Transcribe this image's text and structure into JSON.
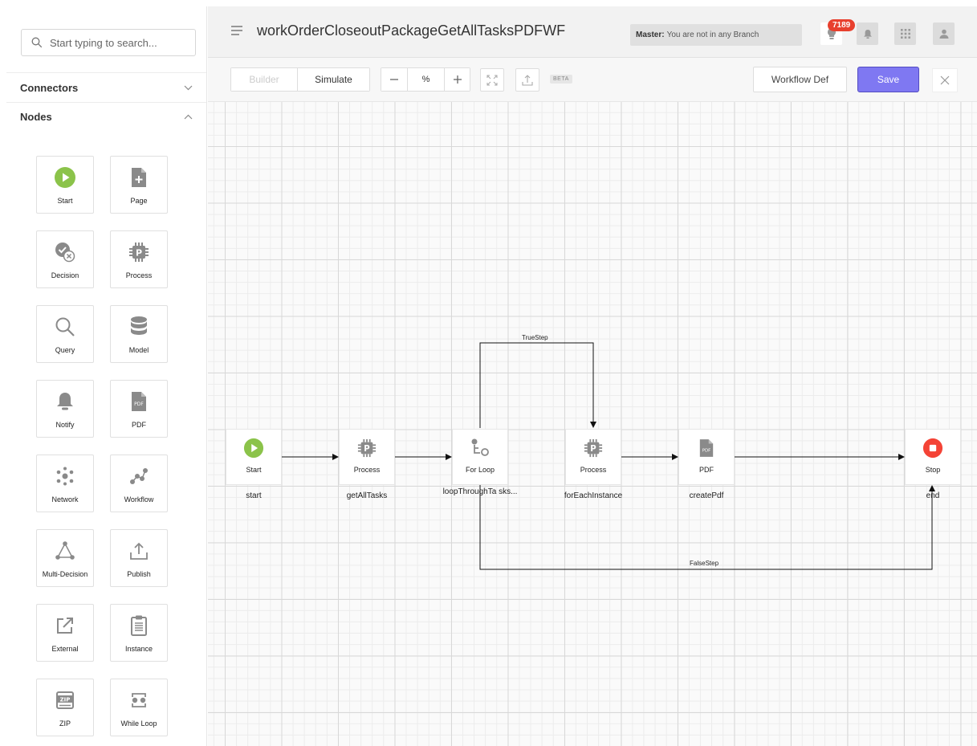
{
  "sidebar": {
    "search_placeholder": "Start typing to search...",
    "connectors_label": "Connectors",
    "nodes_label": "Nodes",
    "node_palette": [
      {
        "label": "Start",
        "icon": "start-icon"
      },
      {
        "label": "Page",
        "icon": "page-icon"
      },
      {
        "label": "Decision",
        "icon": "decision-icon"
      },
      {
        "label": "Process",
        "icon": "process-icon"
      },
      {
        "label": "Query",
        "icon": "query-icon"
      },
      {
        "label": "Model",
        "icon": "model-icon"
      },
      {
        "label": "Notify",
        "icon": "notify-icon"
      },
      {
        "label": "PDF",
        "icon": "pdf-icon"
      },
      {
        "label": "Network",
        "icon": "network-icon"
      },
      {
        "label": "Workflow",
        "icon": "workflow-icon"
      },
      {
        "label": "Multi-Decision",
        "icon": "multi-decision-icon"
      },
      {
        "label": "Publish",
        "icon": "publish-icon"
      },
      {
        "label": "External",
        "icon": "external-icon"
      },
      {
        "label": "Instance",
        "icon": "instance-icon"
      },
      {
        "label": "ZIP",
        "icon": "zip-icon"
      },
      {
        "label": "While Loop",
        "icon": "while-loop-icon"
      }
    ]
  },
  "header": {
    "title": "workOrderCloseoutPackageGetAllTasksPDFWF",
    "branch_prefix": "Master:",
    "branch_text": "You are not in any Branch",
    "notification_count": "7189"
  },
  "toolbar": {
    "builder_label": "Builder",
    "simulate_label": "Simulate",
    "zoom_value": "%",
    "beta_label": "BETA",
    "workflow_def_label": "Workflow Def",
    "save_label": "Save"
  },
  "workflow": {
    "nodes": [
      {
        "type": "Start",
        "name": "start",
        "icon": "start-icon"
      },
      {
        "type": "Process",
        "name": "getAllTasks",
        "icon": "process-icon"
      },
      {
        "type": "For Loop",
        "name": "loopThroughTa sks...",
        "icon": "for-loop-icon"
      },
      {
        "type": "Process",
        "name": "forEachInstance",
        "icon": "process-icon"
      },
      {
        "type": "PDF",
        "name": "createPdf",
        "icon": "pdf-icon"
      },
      {
        "type": "Stop",
        "name": "end",
        "icon": "stop-icon"
      }
    ],
    "edge_labels": {
      "true_step": "TrueStep",
      "false_step": "FalseStep"
    }
  },
  "colors": {
    "accent": "#7f78f2",
    "start_green": "#8bc34a",
    "stop_red": "#f44336",
    "badge_red": "#e8402e",
    "icon_gray": "#8a8a8a"
  }
}
